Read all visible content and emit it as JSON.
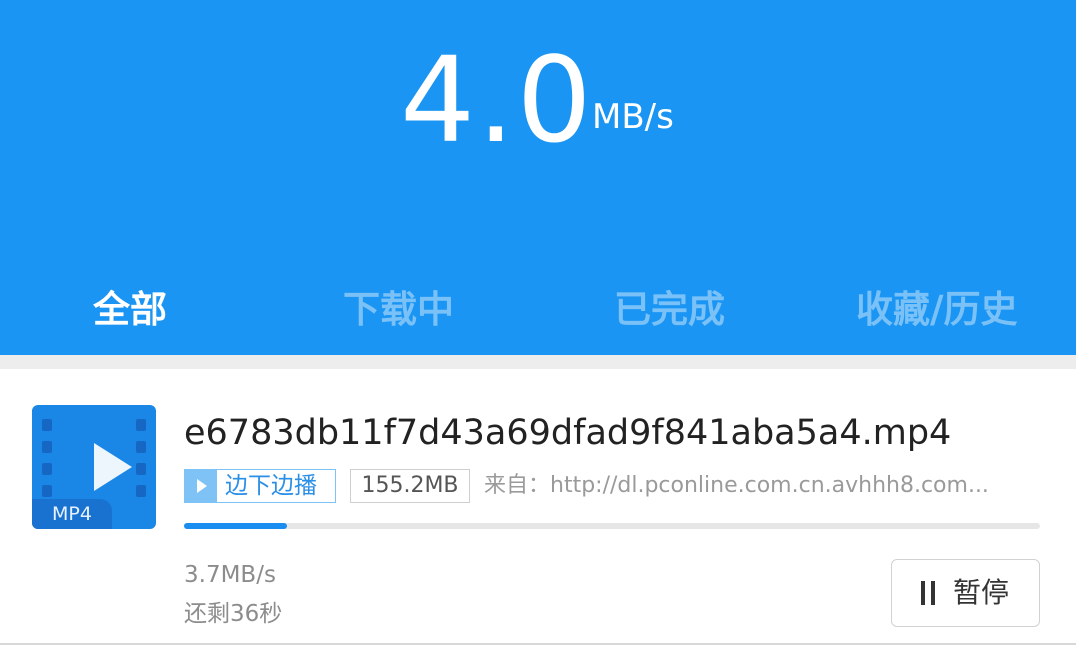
{
  "header": {
    "speed_value": "4.0",
    "speed_unit": "MB/s",
    "background_color": "#1a95f3"
  },
  "tabs": [
    {
      "label": "全部",
      "active": true
    },
    {
      "label": "下载中",
      "active": false
    },
    {
      "label": "已完成",
      "active": false
    },
    {
      "label": "收藏/历史",
      "active": false
    }
  ],
  "downloads": [
    {
      "thumbnail_icon": "video-file-icon",
      "format_label": "MP4",
      "filename": "e6783db11f7d43a69dfad9f841aba5a4.mp4",
      "play_while_download_label": "边下边播",
      "size": "155.2MB",
      "source": "来自：http://dl.pconline.com.cn.avhhh8.com...",
      "progress_fraction": 0.12,
      "rate": "3.7MB/s",
      "remaining": "还剩36秒",
      "pause_label": "暂停",
      "pause_icon": "pause-icon"
    }
  ],
  "colors": {
    "accent": "#1a8ef0",
    "play_badge": "#7fc3f6"
  }
}
